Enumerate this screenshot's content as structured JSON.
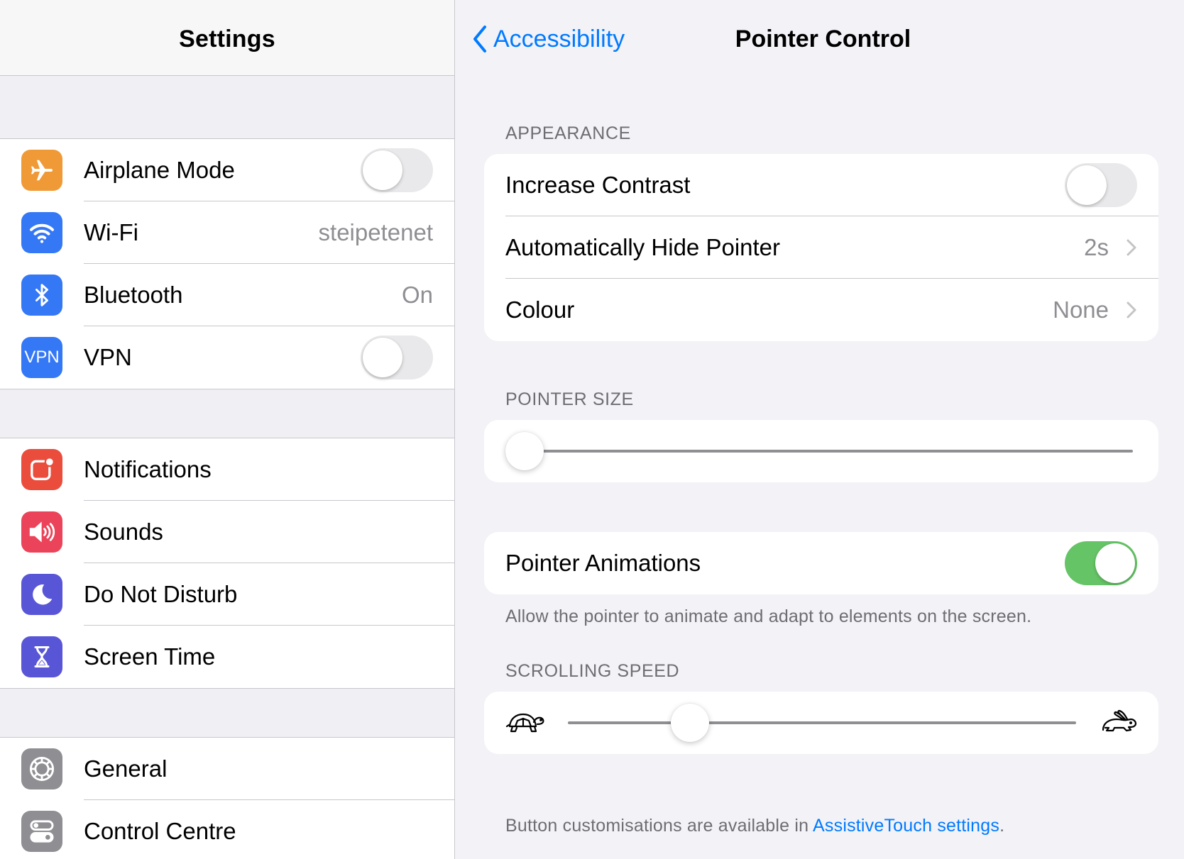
{
  "master": {
    "title": "Settings",
    "groups": [
      {
        "items": [
          {
            "label": "Airplane Mode",
            "icon": "airplane-icon",
            "color": "#f09a37",
            "control": "toggle",
            "on": false
          },
          {
            "label": "Wi-Fi",
            "icon": "wifi-icon",
            "color": "#3478f6",
            "value": "steipetenet"
          },
          {
            "label": "Bluetooth",
            "icon": "bluetooth-icon",
            "color": "#3478f6",
            "value": "On"
          },
          {
            "label": "VPN",
            "icon": "vpn-icon",
            "icon_text": "VPN",
            "color": "#3478f6",
            "control": "toggle",
            "on": false
          }
        ]
      },
      {
        "items": [
          {
            "label": "Notifications",
            "icon": "notifications-icon",
            "color": "#eb4d3d"
          },
          {
            "label": "Sounds",
            "icon": "speaker-icon",
            "color": "#eb445a"
          },
          {
            "label": "Do Not Disturb",
            "icon": "moon-icon",
            "color": "#5856d6"
          },
          {
            "label": "Screen Time",
            "icon": "hourglass-icon",
            "color": "#5856d6"
          }
        ]
      },
      {
        "items": [
          {
            "label": "General",
            "icon": "gear-icon",
            "color": "#8e8e93"
          },
          {
            "label": "Control Centre",
            "icon": "control-centre-icon",
            "color": "#8e8e93"
          }
        ]
      }
    ]
  },
  "detail": {
    "back_label": "Accessibility",
    "title": "Pointer Control",
    "appearance": {
      "header": "APPEARANCE",
      "increase_contrast": {
        "label": "Increase Contrast",
        "on": false
      },
      "auto_hide": {
        "label": "Automatically Hide Pointer",
        "value": "2s"
      },
      "colour": {
        "label": "Colour",
        "value": "None"
      }
    },
    "pointer_size": {
      "header": "POINTER SIZE",
      "level": 0.0
    },
    "pointer_animations": {
      "label": "Pointer Animations",
      "on": true,
      "footer": "Allow the pointer to animate and adapt to elements on the screen."
    },
    "scrolling_speed": {
      "header": "SCROLLING SPEED",
      "level": 0.24,
      "slow_icon": "turtle-icon",
      "fast_icon": "hare-icon"
    },
    "footer": {
      "text": "Button customisations are available in ",
      "link": "AssistiveTouch settings",
      "suffix": "."
    }
  },
  "colors": {
    "accent": "#007aff",
    "toggle_on": "#65c466",
    "toggle_off": "#e9e9eb"
  }
}
